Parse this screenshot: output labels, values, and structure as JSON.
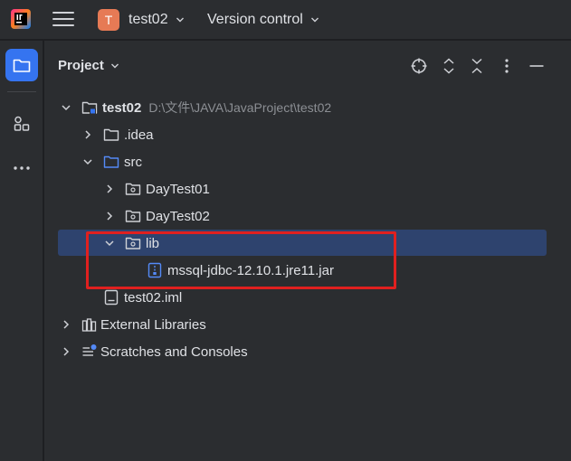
{
  "topbar": {
    "project_initial": "T",
    "project_name": "test02",
    "vcs_label": "Version control"
  },
  "panel": {
    "title": "Project"
  },
  "tree": {
    "root": {
      "label": "test02",
      "path": "D:\\文件\\JAVA\\JavaProject\\test02"
    },
    "idea": {
      "label": ".idea"
    },
    "src": {
      "label": "src"
    },
    "daytest01": {
      "label": "DayTest01"
    },
    "daytest02": {
      "label": "DayTest02"
    },
    "lib": {
      "label": "lib"
    },
    "jar": {
      "label": "mssql-jdbc-12.10.1.jre11.jar"
    },
    "iml": {
      "label": "test02.iml"
    },
    "external": {
      "label": "External Libraries"
    },
    "scratches": {
      "label": "Scratches and Consoles"
    }
  },
  "colors": {
    "accent": "#3574f0",
    "selection": "#2e436e",
    "annotation": "#e0201f",
    "project_avatar": "#e67a55"
  }
}
